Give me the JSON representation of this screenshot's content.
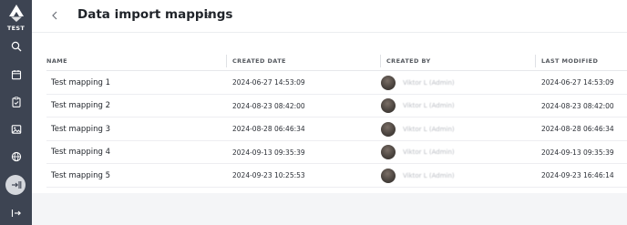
{
  "sidebar": {
    "env_label": "TEST",
    "items": [
      {
        "icon": "search-icon"
      },
      {
        "icon": "calendar-icon"
      },
      {
        "icon": "clipboard-check-icon"
      },
      {
        "icon": "image-icon"
      },
      {
        "icon": "globe-icon"
      },
      {
        "icon": "import-icon",
        "active": true
      },
      {
        "icon": "logout-icon"
      }
    ]
  },
  "header": {
    "title": "Data import mappings",
    "count": "5"
  },
  "table": {
    "columns": [
      "NAME",
      "CREATED DATE",
      "CREATED BY",
      "LAST MODIFIED"
    ],
    "rows": [
      {
        "name": "Test mapping 1",
        "created": "2024-06-27 14:53:09",
        "by": "Viktor L (Admin)",
        "modified": "2024-06-27 14:53:09"
      },
      {
        "name": "Test mapping 2",
        "created": "2024-08-23 08:42:00",
        "by": "Viktor L (Admin)",
        "modified": "2024-08-23 08:42:00"
      },
      {
        "name": "Test mapping 3",
        "created": "2024-08-28 06:46:34",
        "by": "Viktor L (Admin)",
        "modified": "2024-08-28 06:46:34"
      },
      {
        "name": "Test mapping 4",
        "created": "2024-09-13 09:35:39",
        "by": "Viktor L (Admin)",
        "modified": "2024-09-13 09:35:39"
      },
      {
        "name": "Test mapping 5",
        "created": "2024-09-23 10:25:53",
        "by": "Viktor L (Admin)",
        "modified": "2024-09-23 16:46:14"
      }
    ]
  },
  "colors": {
    "sidebar_bg": "#3d4452",
    "active_item_bg": "#d5d8dd"
  }
}
